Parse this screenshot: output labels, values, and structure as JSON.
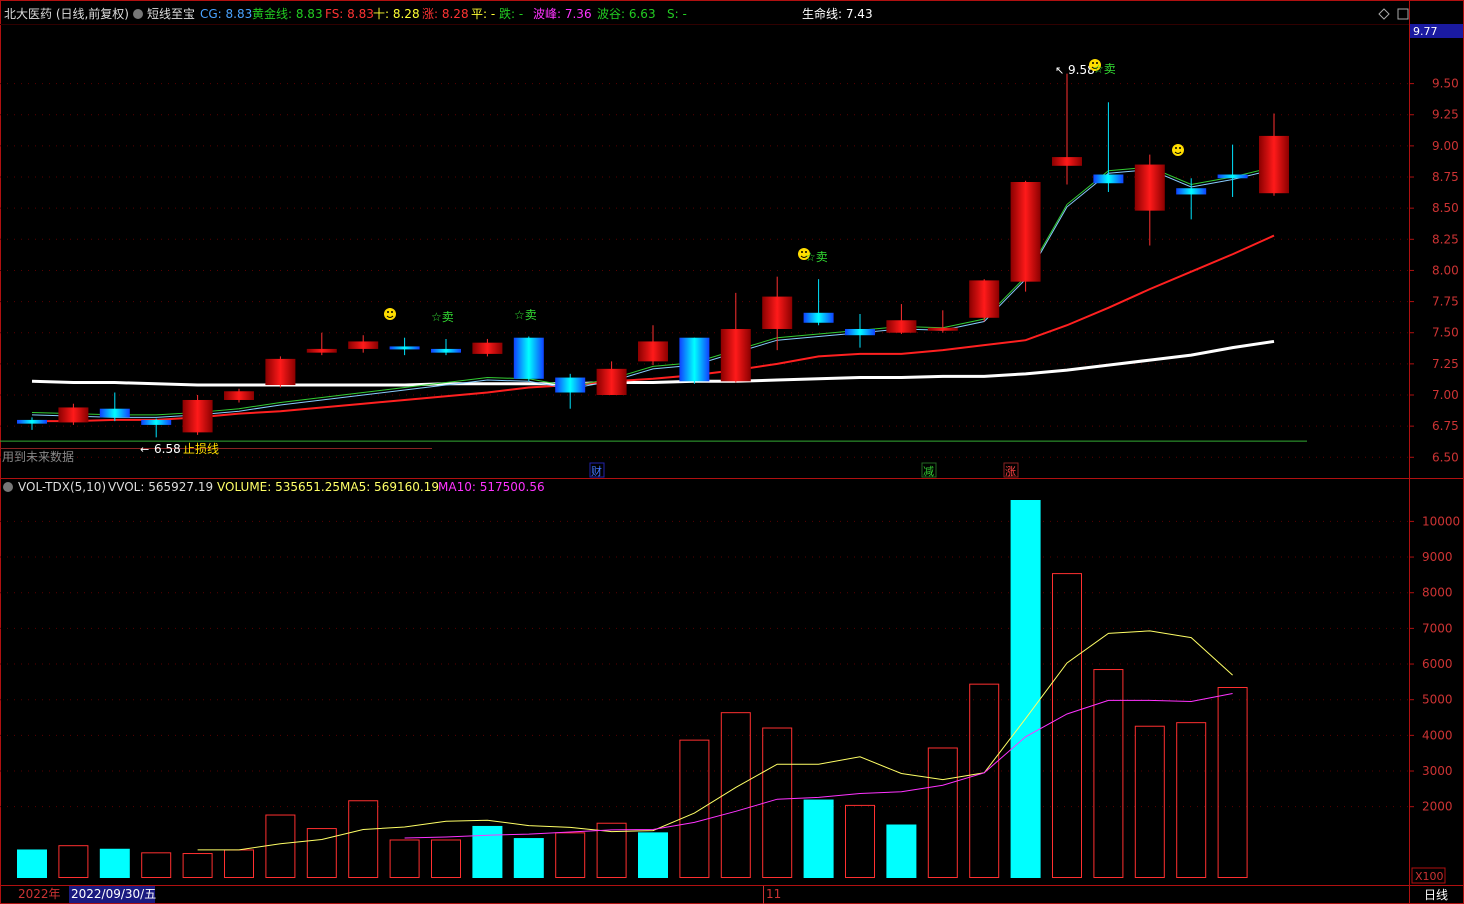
{
  "header": {
    "stock": "北大医药 (日线,前复权)",
    "indicator": "短线至宝",
    "items": [
      {
        "label": "CG: 8.83",
        "color": "#4aa3ff"
      },
      {
        "label": "黄金线: 8.83",
        "color": "#22cc22"
      },
      {
        "label": "FS: 8.83",
        "color": "#ff3333"
      },
      {
        "label": "十: 8.28",
        "color": "#ffff33"
      },
      {
        "label": "涨: 8.28",
        "color": "#ff3333"
      },
      {
        "label": "平: -",
        "color": "#ffff33"
      },
      {
        "label": "跌: -",
        "color": "#22cc22"
      },
      {
        "label": "波峰: 7.36",
        "color": "#ff33ff"
      },
      {
        "label": "波谷: 6.63",
        "color": "#22cc22"
      },
      {
        "label": "S: -",
        "color": "#22cc22"
      }
    ],
    "lifeline": "生命线: 7.43"
  },
  "vol_header": {
    "name": "VOL-TDX(5,10)",
    "vvol": "VVOL: 565927.19",
    "volume": "VOLUME: 535651.25",
    "ma5": "MA5: 569160.19",
    "ma10": "MA10: 517500.56"
  },
  "annotations": {
    "high_label": "9.58",
    "low_label": "6.58",
    "stoploss": "止损线",
    "future_data": "用到未来数据",
    "sell": "☆卖",
    "event_cai": "财",
    "event_jian": "减",
    "event_zhang": "涨",
    "price_tag": "9.77"
  },
  "footer": {
    "year": "2022年",
    "date": "2022/09/30/五",
    "month": "11",
    "period": "日线",
    "vol_unit": "X100"
  },
  "colors": {
    "up": "#ff2020",
    "down": "#00ffff",
    "lifeline": "#ffffff",
    "fs": "#ff2020",
    "ma5": "#ffff66",
    "ma10": "#ff33ff",
    "axis": "#b01010"
  },
  "chart_data": [
    {
      "type": "candlestick",
      "yaxis_ticks": [
        6.5,
        6.75,
        7.0,
        7.25,
        7.5,
        7.75,
        8.0,
        8.25,
        8.5,
        8.75,
        9.0,
        9.25,
        9.5
      ],
      "ylim": [
        6.43,
        9.85
      ],
      "candles": [
        {
          "o": 6.8,
          "h": 6.82,
          "l": 6.72,
          "c": 6.77
        },
        {
          "o": 6.78,
          "h": 6.93,
          "l": 6.76,
          "c": 6.9
        },
        {
          "o": 6.89,
          "h": 7.02,
          "l": 6.79,
          "c": 6.82
        },
        {
          "o": 6.8,
          "h": 6.81,
          "l": 6.66,
          "c": 6.76
        },
        {
          "o": 6.7,
          "h": 7.0,
          "l": 6.68,
          "c": 6.96
        },
        {
          "o": 6.96,
          "h": 7.05,
          "l": 6.94,
          "c": 7.03
        },
        {
          "o": 7.08,
          "h": 7.31,
          "l": 7.06,
          "c": 7.29
        },
        {
          "o": 7.34,
          "h": 7.5,
          "l": 7.32,
          "c": 7.37
        },
        {
          "o": 7.37,
          "h": 7.48,
          "l": 7.34,
          "c": 7.43
        },
        {
          "o": 7.39,
          "h": 7.46,
          "l": 7.32,
          "c": 7.37
        },
        {
          "o": 7.37,
          "h": 7.45,
          "l": 7.32,
          "c": 7.34
        },
        {
          "o": 7.33,
          "h": 7.45,
          "l": 7.31,
          "c": 7.42
        },
        {
          "o": 7.46,
          "h": 7.47,
          "l": 7.11,
          "c": 7.13
        },
        {
          "o": 7.14,
          "h": 7.17,
          "l": 6.89,
          "c": 7.02
        },
        {
          "o": 7.0,
          "h": 7.27,
          "l": 7.0,
          "c": 7.21
        },
        {
          "o": 7.27,
          "h": 7.56,
          "l": 7.24,
          "c": 7.43
        },
        {
          "o": 7.46,
          "h": 7.46,
          "l": 7.09,
          "c": 7.11
        },
        {
          "o": 7.11,
          "h": 7.82,
          "l": 7.1,
          "c": 7.53
        },
        {
          "o": 7.53,
          "h": 7.95,
          "l": 7.36,
          "c": 7.79
        },
        {
          "o": 7.66,
          "h": 7.93,
          "l": 7.56,
          "c": 7.58
        },
        {
          "o": 7.53,
          "h": 7.65,
          "l": 7.38,
          "c": 7.48
        },
        {
          "o": 7.5,
          "h": 7.73,
          "l": 7.49,
          "c": 7.6
        },
        {
          "o": 7.53,
          "h": 7.68,
          "l": 7.5,
          "c": 7.54
        },
        {
          "o": 7.62,
          "h": 7.93,
          "l": 7.59,
          "c": 7.92
        },
        {
          "o": 7.91,
          "h": 8.72,
          "l": 7.83,
          "c": 8.71
        },
        {
          "o": 8.84,
          "h": 9.58,
          "l": 8.69,
          "c": 8.91
        },
        {
          "o": 8.77,
          "h": 9.35,
          "l": 8.63,
          "c": 8.7
        },
        {
          "o": 8.48,
          "h": 8.93,
          "l": 8.2,
          "c": 8.85
        },
        {
          "o": 8.66,
          "h": 8.74,
          "l": 8.41,
          "c": 8.61
        },
        {
          "o": 8.77,
          "h": 9.01,
          "l": 8.59,
          "c": 8.74
        },
        {
          "o": 8.62,
          "h": 9.26,
          "l": 8.6,
          "c": 9.08
        }
      ],
      "fs_line": [
        6.86,
        6.85,
        6.84,
        6.84,
        6.86,
        6.89,
        6.94,
        6.98,
        7.02,
        7.06,
        7.1,
        7.14,
        7.13,
        7.07,
        7.13,
        7.23,
        7.26,
        7.36,
        7.46,
        7.49,
        7.52,
        7.55,
        7.54,
        7.61,
        7.95,
        8.53,
        8.8,
        8.83,
        8.69,
        8.75,
        8.83
      ],
      "lifeline": [
        7.11,
        7.1,
        7.1,
        7.09,
        7.08,
        7.08,
        7.08,
        7.08,
        7.08,
        7.08,
        7.09,
        7.09,
        7.09,
        7.09,
        7.1,
        7.1,
        7.11,
        7.11,
        7.12,
        7.13,
        7.14,
        7.14,
        7.15,
        7.15,
        7.17,
        7.2,
        7.24,
        7.28,
        7.32,
        7.38,
        7.43
      ],
      "mid_line": [
        6.79,
        6.79,
        6.8,
        6.8,
        6.82,
        6.85,
        6.87,
        6.9,
        6.93,
        6.96,
        6.99,
        7.02,
        7.06,
        7.08,
        7.11,
        7.13,
        7.16,
        7.2,
        7.25,
        7.31,
        7.33,
        7.33,
        7.36,
        7.4,
        7.44,
        7.56,
        7.7,
        7.85,
        7.99,
        8.13,
        8.28
      ],
      "stoploss": 6.63,
      "high_label_value": 9.58,
      "low_label_value": 6.58
    },
    {
      "type": "bar",
      "ylabel_unit": "X100",
      "yaxis_ticks": [
        2000,
        3000,
        4000,
        5000,
        6000,
        7000,
        8000,
        9000,
        10000
      ],
      "ylim": [
        0,
        11000
      ],
      "values": [
        800,
        920,
        820,
        720,
        700,
        800,
        1780,
        1400,
        2180,
        1080,
        1080,
        1460,
        1120,
        1280,
        1550,
        1280,
        3880,
        4650,
        4220,
        2200,
        2050,
        1500,
        3660,
        5450,
        10600,
        8550,
        5860,
        4270,
        4370,
        5356
      ],
      "down": [
        true,
        false,
        true,
        false,
        false,
        false,
        false,
        false,
        false,
        false,
        false,
        true,
        true,
        false,
        false,
        true,
        false,
        false,
        false,
        true,
        false,
        true,
        false,
        false,
        true,
        false,
        false,
        false,
        false,
        false
      ],
      "ma5": [
        null,
        null,
        null,
        null,
        790,
        790,
        960,
        1080,
        1360,
        1430,
        1590,
        1620,
        1470,
        1420,
        1300,
        1330,
        1820,
        2540,
        3190,
        3190,
        3400,
        2930,
        2760,
        2950,
        4470,
        6030,
        6860,
        6930,
        6740,
        5690
      ],
      "ma10": [
        null,
        null,
        null,
        null,
        null,
        null,
        null,
        null,
        null,
        1120,
        1150,
        1200,
        1230,
        1290,
        1350,
        1360,
        1560,
        1870,
        2210,
        2260,
        2370,
        2420,
        2600,
        2950,
        3960,
        4600,
        4980,
        4980,
        4950,
        5175
      ]
    }
  ]
}
